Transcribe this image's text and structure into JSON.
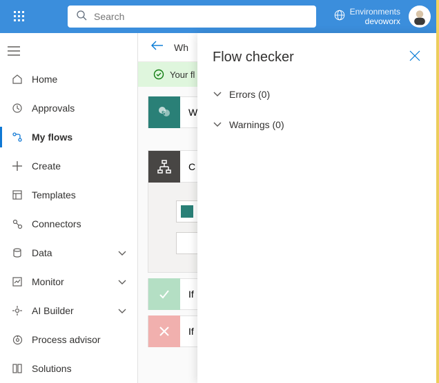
{
  "header": {
    "search_placeholder": "Search",
    "env_label": "Environments",
    "env_name": "devoworx "
  },
  "sidebar": {
    "items": [
      {
        "label": "Home"
      },
      {
        "label": "Approvals"
      },
      {
        "label": "My flows"
      },
      {
        "label": "Create"
      },
      {
        "label": "Templates"
      },
      {
        "label": "Connectors"
      },
      {
        "label": "Data"
      },
      {
        "label": "Monitor"
      },
      {
        "label": "AI Builder"
      },
      {
        "label": "Process advisor"
      },
      {
        "label": "Solutions"
      }
    ]
  },
  "toolbar": {
    "title": "Wh"
  },
  "notice": {
    "text": "Your fl"
  },
  "flow": {
    "trigger_label": "W",
    "condition_label": "C",
    "yes_label": "If ",
    "no_label": "If "
  },
  "panel": {
    "title": "Flow checker",
    "errors_label": "Errors (0)",
    "warnings_label": "Warnings (0)"
  }
}
